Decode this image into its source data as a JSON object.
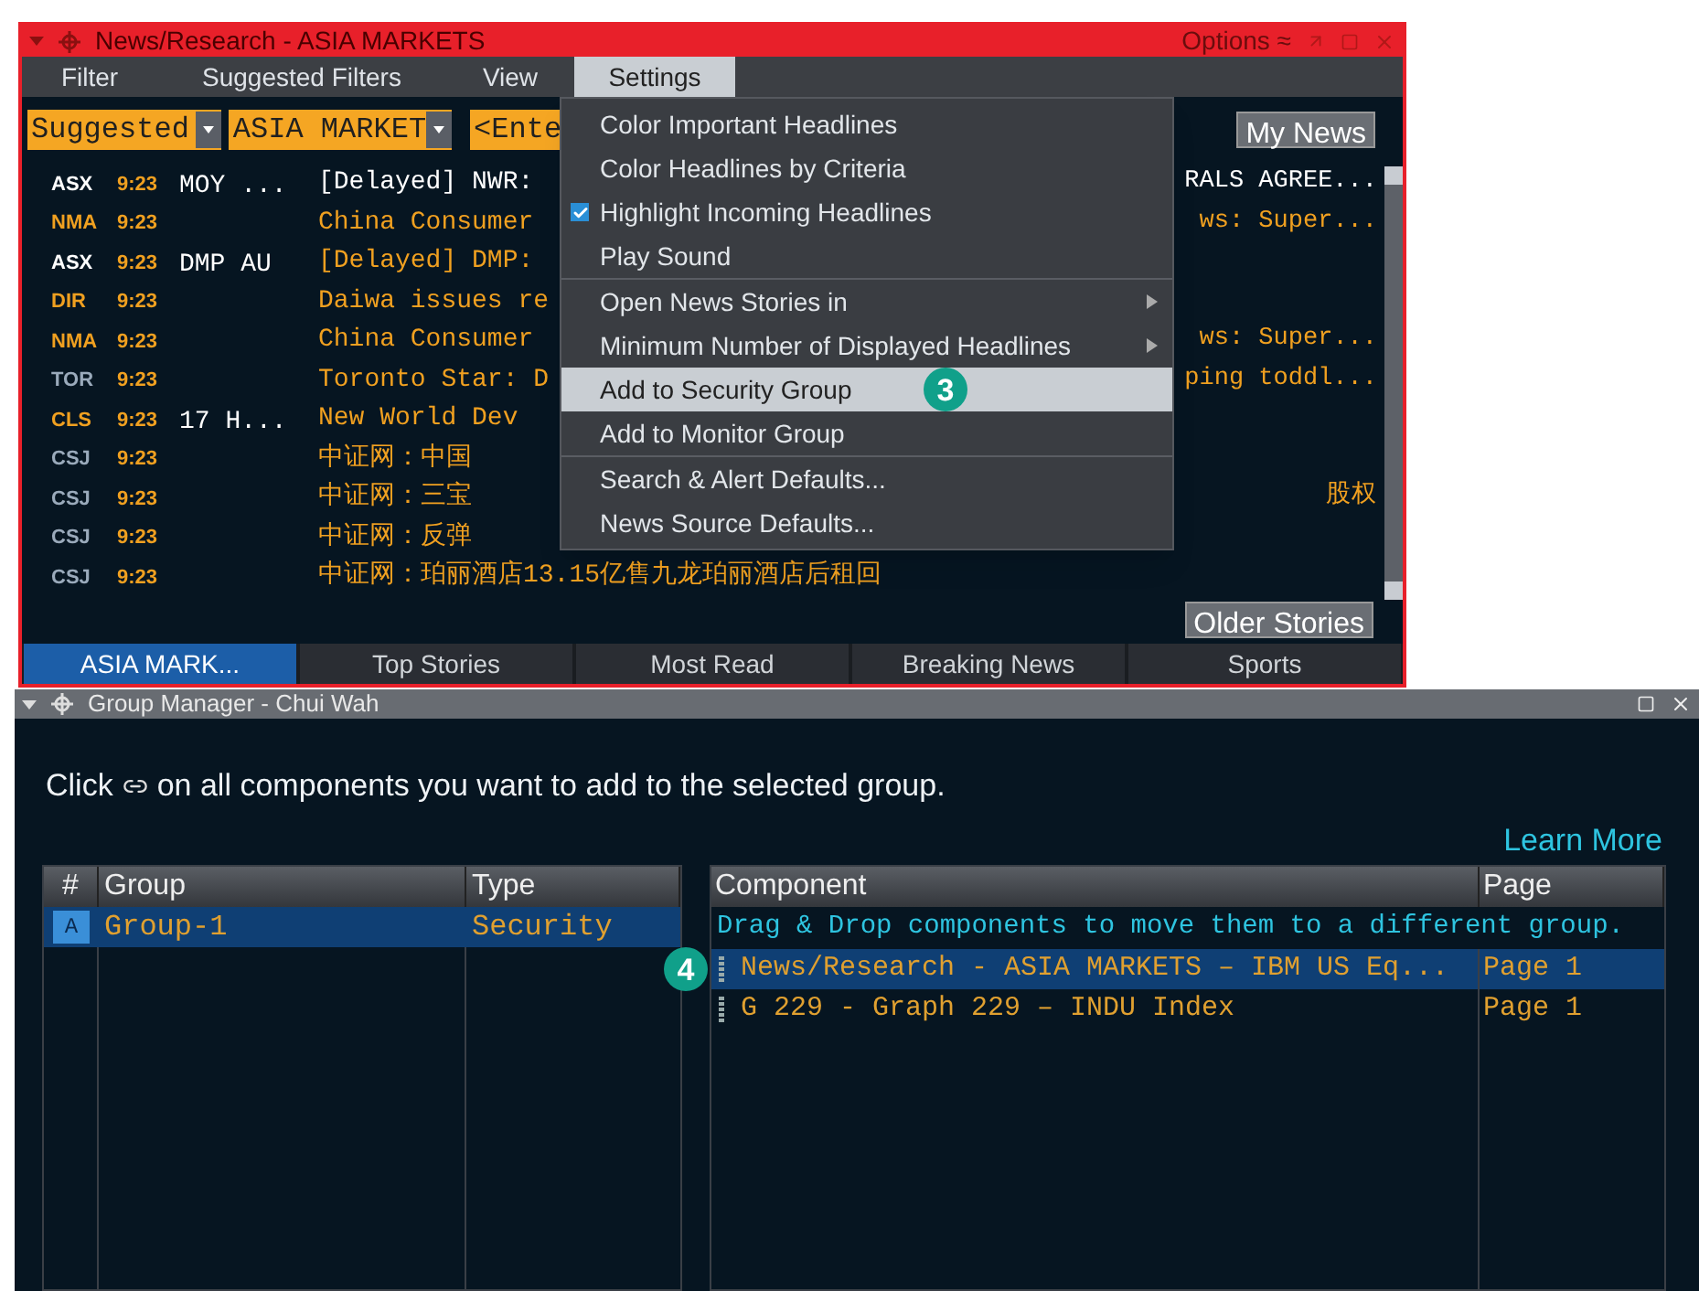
{
  "news_window": {
    "title": "News/Research - ASIA MARKETS",
    "options": "Options ≈",
    "menu_bar": [
      {
        "label": "Filter",
        "selected": false
      },
      {
        "label": "Suggested Filters",
        "selected": false
      },
      {
        "label": "View",
        "selected": false
      },
      {
        "label": "Settings",
        "selected": true
      }
    ],
    "filters": {
      "suggested": "Suggested",
      "market": "ASIA MARKET",
      "field_placeholder": "<Ente",
      "my_news": "My News"
    },
    "rows": [
      {
        "source": "ASX",
        "color": "#ffffff",
        "time": "9:23",
        "ticker": "MOY ...",
        "headline": {
          "left": "[Delayed] NWR:",
          "right": "RALS AGREE...",
          "color": "#ffffff"
        }
      },
      {
        "source": "NMA",
        "color": "#f0a020",
        "time": "9:23",
        "headline": {
          "left": "China Consumer",
          "right": "ws: Super...",
          "color": "#f0a020"
        }
      },
      {
        "source": "ASX",
        "color": "#ffffff",
        "time": "9:23",
        "ticker": "DMP AU",
        "headline": {
          "left": "[Delayed] DMP:",
          "color": "#f0a020"
        }
      },
      {
        "source": "DIR",
        "color": "#f0a020",
        "time": "9:23",
        "headline": {
          "left": "Daiwa issues re",
          "color": "#f0a020"
        }
      },
      {
        "source": "NMA",
        "color": "#f0a020",
        "time": "9:23",
        "headline": {
          "left": "China Consumer",
          "right": "ws: Super...",
          "color": "#f0a020"
        }
      },
      {
        "source": "TOR",
        "color": "#9aaabb",
        "time": "9:23",
        "headline": {
          "left": "Toronto Star: D",
          "right": "ping toddl...",
          "color": "#f0a020"
        }
      },
      {
        "source": "CLS",
        "color": "#f0a020",
        "time": "9:23",
        "ticker": "17 H...",
        "headline": {
          "left": "New World Dev",
          "color": "#f0a020"
        }
      },
      {
        "source": "CSJ",
        "color": "#9aaabb",
        "time": "9:23",
        "headline": {
          "left": "中证网：中国",
          "color": "#f0a020"
        }
      },
      {
        "source": "CSJ",
        "color": "#9aaabb",
        "time": "9:23",
        "headline": {
          "left": "中证网：三宝",
          "right": "股权",
          "color": "#f0a020"
        }
      },
      {
        "source": "CSJ",
        "color": "#9aaabb",
        "time": "9:23",
        "headline": {
          "left": "中证网：反弹",
          "color": "#f0a020"
        }
      },
      {
        "source": "CSJ",
        "color": "#9aaabb",
        "time": "9:23",
        "headline": {
          "left": "中证网：珀丽酒店13.15亿售九龙珀丽酒店后租回",
          "color": "#f0a020"
        }
      }
    ],
    "older_stories": "Older Stories",
    "tabs": [
      {
        "label": "ASIA MARK...",
        "selected": true
      },
      {
        "label": "Top Stories",
        "selected": false
      },
      {
        "label": "Most Read",
        "selected": false
      },
      {
        "label": "Breaking News",
        "selected": false
      },
      {
        "label": "Sports",
        "selected": false
      }
    ],
    "settings_menu": [
      [
        {
          "label": "Color Important Headlines",
          "kind": "toggle",
          "checked": false,
          "selected": false
        },
        {
          "label": "Color Headlines by Criteria",
          "kind": "toggle",
          "checked": false,
          "selected": false
        },
        {
          "label": "Highlight Incoming Headlines",
          "kind": "toggle",
          "checked": true,
          "selected": false
        },
        {
          "label": "Play Sound",
          "kind": "toggle",
          "checked": false,
          "selected": false
        }
      ],
      [
        {
          "label": "Open News Stories in",
          "kind": "submenu",
          "selected": false
        },
        {
          "label": "Minimum Number of Displayed Headlines",
          "kind": "submenu",
          "selected": false
        },
        {
          "label": "Add to Security Group",
          "kind": "action",
          "selected": true,
          "badge": "3"
        },
        {
          "label": "Add to Monitor Group",
          "kind": "action",
          "selected": false
        }
      ],
      [
        {
          "label": "Search & Alert Defaults...",
          "kind": "action",
          "selected": false
        },
        {
          "label": "News Source Defaults...",
          "kind": "action",
          "selected": false
        }
      ]
    ]
  },
  "group_manager": {
    "title": "Group Manager - Chui Wah",
    "instruction_start": "Click",
    "instruction_end": "on all components you want to add to the selected group.",
    "learn_more": "Learn More",
    "groups_table": {
      "columns": [
        "#",
        "Group",
        "Type"
      ],
      "rows": [
        {
          "id": "A",
          "group": "Group-1",
          "type": "Security",
          "selected": true
        }
      ]
    },
    "components_table": {
      "columns": [
        "Component",
        "Page"
      ],
      "hint": "Drag & Drop components to move them to a different group.",
      "rows": [
        {
          "component": "News/Research - ASIA MARKETS – IBM US Eq...",
          "page": "Page 1",
          "selected": true,
          "badge": "4"
        },
        {
          "component": "G 229 - Graph 229 – INDU Index",
          "page": "Page 1",
          "selected": false
        }
      ]
    }
  }
}
